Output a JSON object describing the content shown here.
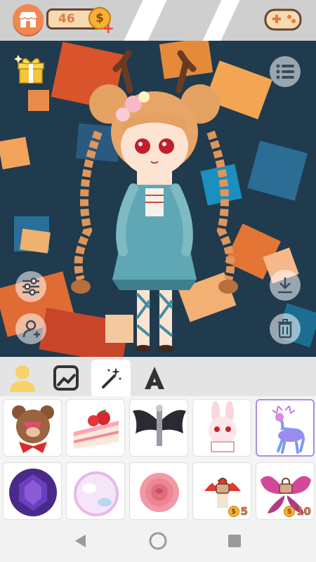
{
  "header": {
    "coin_count": "46",
    "coin_symbol": "$",
    "plus": "+"
  },
  "stage": {
    "buttons": [
      "gift-icon",
      "menu-icon",
      "sliders-icon",
      "add-user-icon",
      "download-icon",
      "trash-icon"
    ]
  },
  "tabs": [
    {
      "icon": "person-icon",
      "active": false
    },
    {
      "icon": "background-image-icon",
      "active": false
    },
    {
      "icon": "magic-wand-icon",
      "active": true
    },
    {
      "icon": "text-a-icon",
      "active": false
    }
  ],
  "items": [
    {
      "name": "bear-item",
      "locked": false,
      "price": null
    },
    {
      "name": "strawberry-cake-item",
      "locked": false,
      "price": null
    },
    {
      "name": "dark-wings-item",
      "locked": false,
      "price": null
    },
    {
      "name": "bunny-item",
      "locked": false,
      "price": null
    },
    {
      "name": "galaxy-deer-item",
      "locked": false,
      "price": null,
      "selected": true
    },
    {
      "name": "purple-gem-item",
      "locked": false,
      "price": null
    },
    {
      "name": "bubble-orb-item",
      "locked": false,
      "price": null
    },
    {
      "name": "pink-rose-item",
      "locked": false,
      "price": null
    },
    {
      "name": "mushroom-item",
      "locked": true,
      "price": "5"
    },
    {
      "name": "butterfly-item",
      "locked": true,
      "price": "10"
    }
  ],
  "colors": {
    "accent_orange": "#f1874f",
    "coin_gold": "#f5b235",
    "selected_border": "#a98de8"
  },
  "nav": [
    "back-icon",
    "home-icon",
    "recents-icon"
  ]
}
